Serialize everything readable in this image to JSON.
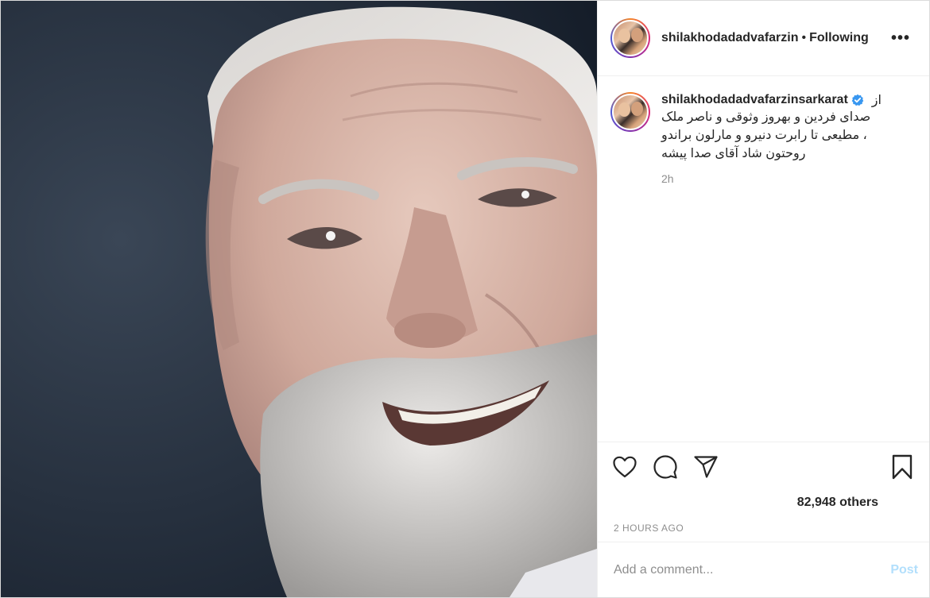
{
  "post": {
    "author": "shilakhodadadvafarzin",
    "separator": "•",
    "follow_status": "Following",
    "more_icon": "more-options-icon",
    "more_label": "•••"
  },
  "caption": {
    "username": "shilakhodadadvafarzinsarkarat",
    "verified": true,
    "first_word": "از",
    "text": "صدای فردین و بهروز وثوقی و ناصر ملک\n، مطیعی تا رابرت دنیرو و مارلون براندو\nروحتون شاد آقای صدا پیشه",
    "relative_time": "2h"
  },
  "actions": {
    "like_icon": "heart-icon",
    "comment_icon": "comment-icon",
    "share_icon": "share-icon",
    "save_icon": "bookmark-icon"
  },
  "likes": {
    "text": "82,948 others"
  },
  "timestamp": "2 HOURS AGO",
  "add_comment": {
    "placeholder": "Add a comment...",
    "post_label": "Post"
  },
  "colors": {
    "verified": "#3897f0",
    "post_disabled": "#b2dffc",
    "muted": "#8e8e8e"
  }
}
